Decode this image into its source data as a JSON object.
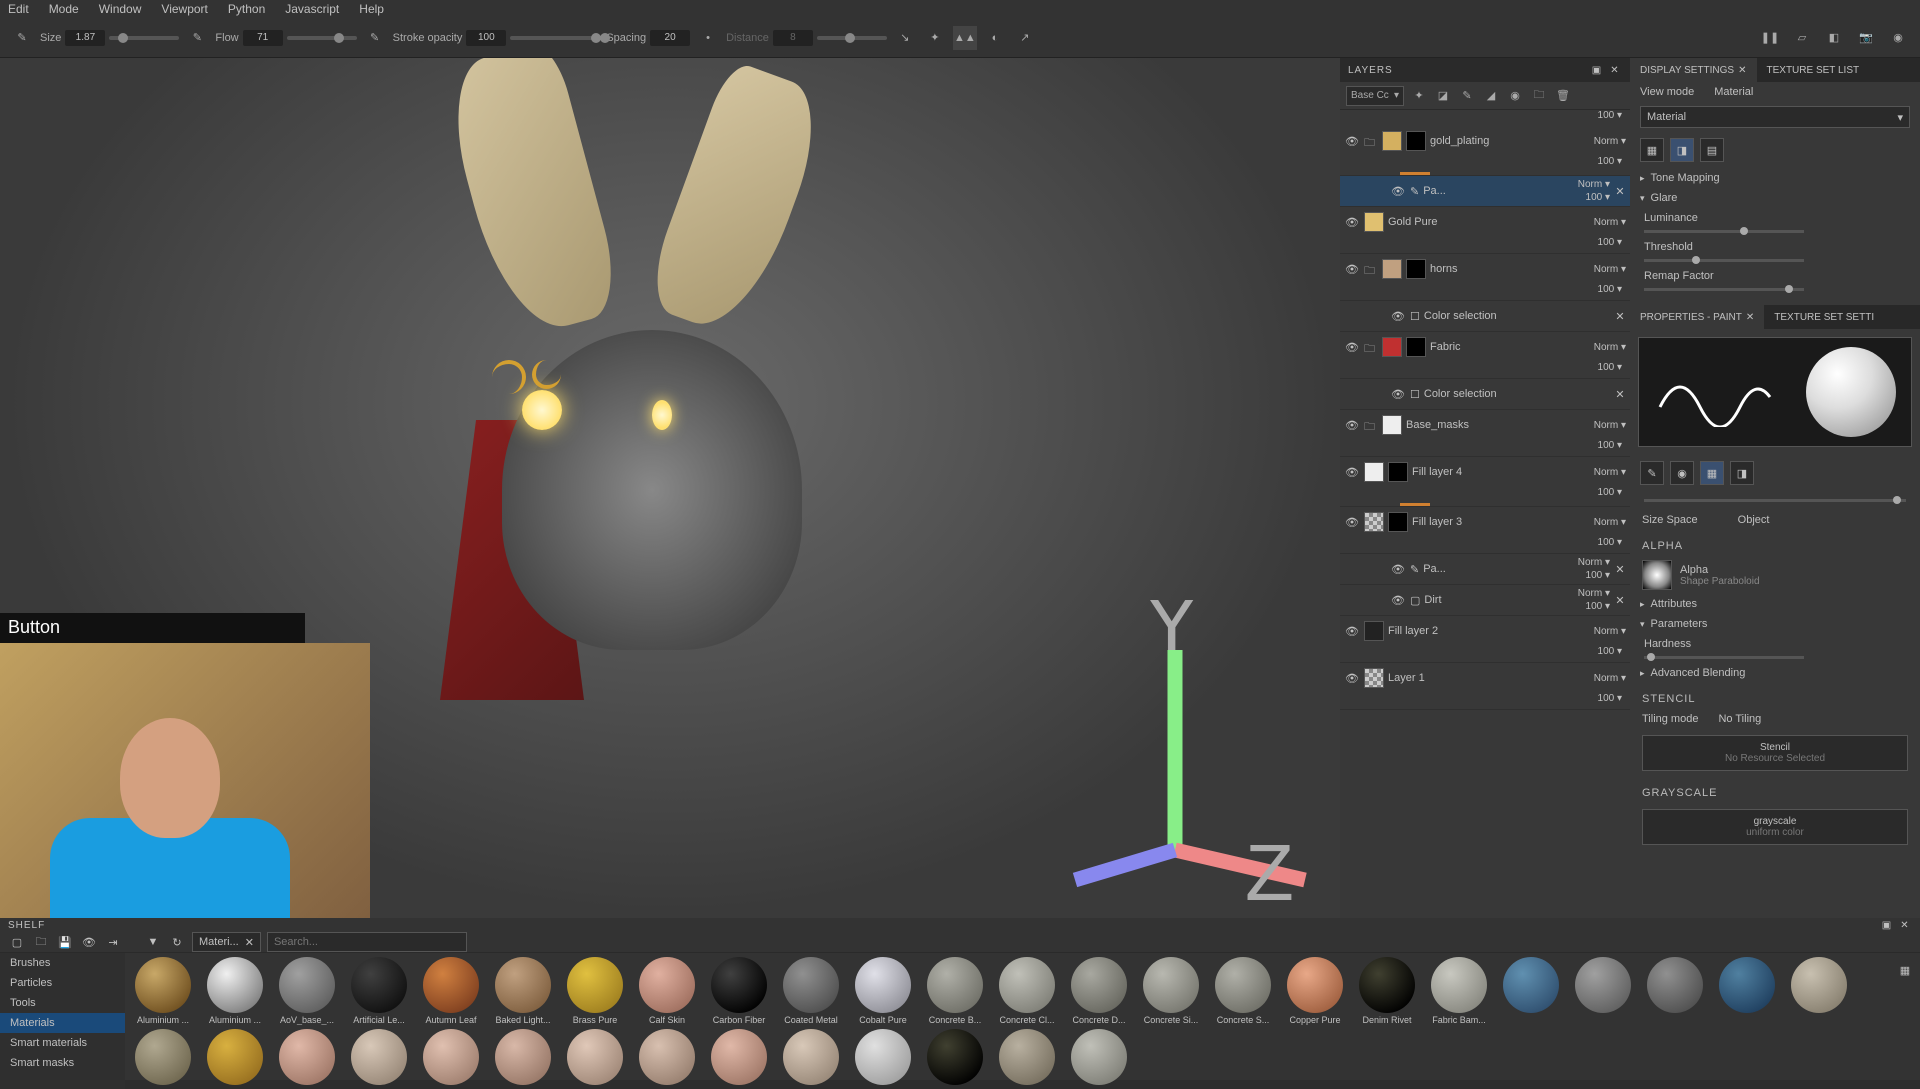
{
  "menubar": [
    "Edit",
    "Mode",
    "Window",
    "Viewport",
    "Python",
    "Javascript",
    "Help"
  ],
  "toolbar": {
    "size_label": "Size",
    "size_val": "1.87",
    "flow_label": "Flow",
    "flow_val": "71",
    "opacity_label": "Stroke opacity",
    "opacity_val": "100",
    "spacing_label": "Spacing",
    "spacing_val": "20",
    "distance_label": "Distance",
    "distance_val": "8"
  },
  "overlay": "Button",
  "layers": {
    "title": "LAYERS",
    "mode_select": "Base Cc",
    "items": [
      {
        "name": "gold_plating",
        "blend": "Norm",
        "op": "100",
        "type": "folder",
        "thumb": "gold",
        "mask": true,
        "bar": true
      },
      {
        "name": "Pa...",
        "blend": "Norm",
        "op": "100",
        "type": "effect",
        "selected": true
      },
      {
        "name": "Gold Pure",
        "blend": "Norm",
        "op": "100",
        "type": "fill",
        "thumb": "pure-gold"
      },
      {
        "name": "horns",
        "blend": "Norm",
        "op": "100",
        "type": "folder",
        "thumb": "tan",
        "mask": true
      },
      {
        "name": "Color selection",
        "type": "adjust"
      },
      {
        "name": "Fabric",
        "blend": "Norm",
        "op": "100",
        "type": "folder",
        "thumb": "red",
        "mask": true
      },
      {
        "name": "Color selection",
        "type": "adjust"
      },
      {
        "name": "Base_masks",
        "blend": "Norm",
        "op": "100",
        "type": "folder",
        "thumb": "white"
      },
      {
        "name": "Fill layer 4",
        "blend": "Norm",
        "op": "100",
        "type": "fill",
        "thumb": "white",
        "mask": true,
        "bar": true
      },
      {
        "name": "Fill layer 3",
        "blend": "Norm",
        "op": "100",
        "type": "fill",
        "thumb": "checker",
        "mask": true
      },
      {
        "name": "Pa...",
        "blend": "Norm",
        "op": "100",
        "type": "effect"
      },
      {
        "name": "Dirt",
        "blend": "Norm",
        "op": "100",
        "type": "effect2"
      },
      {
        "name": "Fill layer 2",
        "blend": "Norm",
        "op": "100",
        "type": "fill",
        "thumb": "dark"
      },
      {
        "name": "Layer 1",
        "blend": "Norm",
        "op": "100",
        "type": "fill",
        "thumb": "checker"
      }
    ]
  },
  "display": {
    "tab1": "DISPLAY SETTINGS",
    "tab2": "TEXTURE SET LIST",
    "view_mode": "View mode",
    "material": "Material",
    "material_val": "Material",
    "tone": "Tone Mapping",
    "glare": "Glare",
    "luminance": "Luminance",
    "threshold": "Threshold",
    "remap": "Remap Factor"
  },
  "props": {
    "tab1": "PROPERTIES - PAINT",
    "tab2": "TEXTURE SET SETTI",
    "size_space": "Size Space",
    "object": "Object",
    "alpha": "ALPHA",
    "alpha_name": "Alpha",
    "alpha_shape": "Shape Paraboloid",
    "attributes": "Attributes",
    "parameters": "Parameters",
    "hardness": "Hardness",
    "advanced": "Advanced Blending",
    "stencil": "STENCIL",
    "tiling": "Tiling mode",
    "no_tiling": "No Tiling",
    "stencil_label": "Stencil",
    "no_resource": "No Resource Selected",
    "grayscale": "GRAYSCALE",
    "gs_name": "grayscale",
    "gs_uniform": "uniform color"
  },
  "shelf": {
    "title": "SHELF",
    "tag": "Materi...",
    "search_ph": "Search...",
    "cats": [
      "Brushes",
      "Particles",
      "Tools",
      "Materials",
      "Smart materials",
      "Smart masks"
    ],
    "active_cat": 3,
    "materials": [
      {
        "n": "Aluminium ...",
        "c1": "#c8a868",
        "c2": "#705020"
      },
      {
        "n": "Aluminium ...",
        "c1": "#f0f0f0",
        "c2": "#808080"
      },
      {
        "n": "AoV_base_...",
        "c1": "#a0a0a0",
        "c2": "#606060"
      },
      {
        "n": "Artificial Le...",
        "c1": "#404040",
        "c2": "#101010"
      },
      {
        "n": "Autumn Leaf",
        "c1": "#d08040",
        "c2": "#804020"
      },
      {
        "n": "Baked Light...",
        "c1": "#c0a080",
        "c2": "#806040"
      },
      {
        "n": "Brass Pure",
        "c1": "#e0c040",
        "c2": "#a08020"
      },
      {
        "n": "Calf Skin",
        "c1": "#e0b0a0",
        "c2": "#a07060"
      },
      {
        "n": "Carbon Fiber",
        "c1": "#404040",
        "c2": "#000000"
      },
      {
        "n": "Coated Metal",
        "c1": "#909090",
        "c2": "#505050"
      },
      {
        "n": "Cobalt Pure",
        "c1": "#e0e0e8",
        "c2": "#909098"
      },
      {
        "n": "Concrete B...",
        "c1": "#b0b0a8",
        "c2": "#707068"
      },
      {
        "n": "Concrete Cl...",
        "c1": "#c0c0b8",
        "c2": "#808078"
      },
      {
        "n": "Concrete D...",
        "c1": "#a8a8a0",
        "c2": "#686860"
      },
      {
        "n": "Concrete Si...",
        "c1": "#b8b8b0",
        "c2": "#787870"
      },
      {
        "n": "Concrete S...",
        "c1": "#b0b0a8",
        "c2": "#707068"
      },
      {
        "n": "Copper Pure",
        "c1": "#e8a888",
        "c2": "#a06040"
      },
      {
        "n": "Denim Rivet",
        "c1": "#404030",
        "c2": "#000000"
      },
      {
        "n": "Fabric Bam...",
        "c1": "#c8c8c0",
        "c2": "#888880"
      }
    ],
    "row2": [
      {
        "c1": "#6090b0",
        "c2": "#305070"
      },
      {
        "c1": "#a0a0a0",
        "c2": "#606060"
      },
      {
        "c1": "#909090",
        "c2": "#505050"
      },
      {
        "c1": "#5080a0",
        "c2": "#204060"
      },
      {
        "c1": "#c8c0b0",
        "c2": "#888070"
      },
      {
        "c1": "#b0a890",
        "c2": "#706850"
      },
      {
        "c1": "#d8b040",
        "c2": "#987020"
      },
      {
        "c1": "#e0b8a8",
        "c2": "#a07868"
      },
      {
        "c1": "#d8c8b8",
        "c2": "#988878"
      },
      {
        "c1": "#e0c0b0",
        "c2": "#a08070"
      },
      {
        "c1": "#d8b8a8",
        "c2": "#987868"
      },
      {
        "c1": "#e0c8b8",
        "c2": "#a08878"
      },
      {
        "c1": "#d8c0b0",
        "c2": "#988070"
      },
      {
        "c1": "#e0b8a8",
        "c2": "#a07868"
      },
      {
        "c1": "#d8c8b8",
        "c2": "#988878"
      },
      {
        "c1": "#e0e0e0",
        "c2": "#a0a0a0"
      },
      {
        "c1": "#404030",
        "c2": "#000000"
      },
      {
        "c1": "#b8b0a0",
        "c2": "#787060"
      },
      {
        "c1": "#c0c0b8",
        "c2": "#808078"
      }
    ]
  }
}
